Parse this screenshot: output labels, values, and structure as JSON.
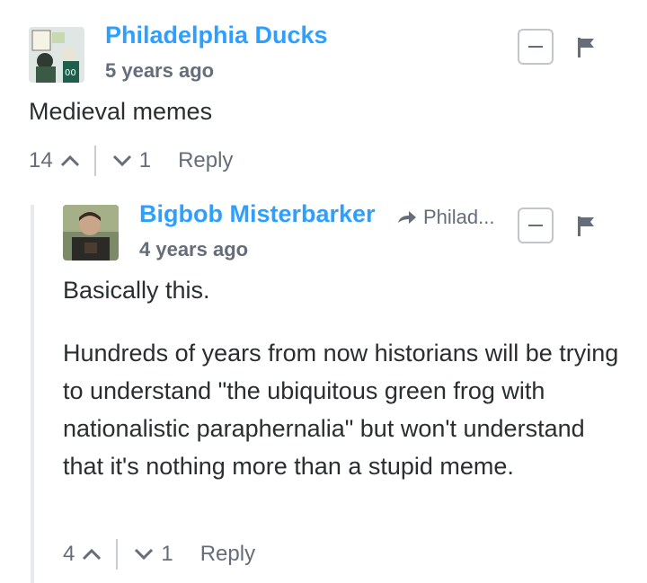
{
  "comments": [
    {
      "author": "Philadelphia Ducks",
      "time": "5 years ago",
      "body": [
        "Medieval memes"
      ],
      "upvotes": "14",
      "downvotes": "1",
      "reply_label": "Reply"
    },
    {
      "author": "Bigbob Misterbarker",
      "reply_to": "Philad...",
      "time": "4 years ago",
      "body": [
        "Basically this.",
        "Hundreds of years from now historians will be trying to understand \"the ubiquitous green frog with nationalistic paraphernalia\" but won't understand that it's nothing more than a stupid meme."
      ],
      "upvotes": "4",
      "downvotes": "1",
      "reply_label": "Reply"
    }
  ],
  "icons": {
    "collapse": "minus-icon",
    "flag": "flag-icon",
    "upvote": "chevron-up-icon",
    "downvote": "chevron-down-icon",
    "reply_to": "arrow-right-icon"
  },
  "colors": {
    "author": "#2e9fff",
    "meta": "#656c7a",
    "text": "#2a2e2e"
  }
}
